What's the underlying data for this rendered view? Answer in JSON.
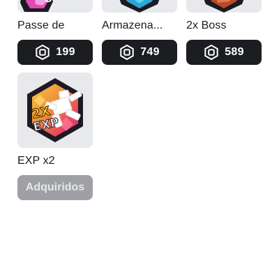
{
  "items": [
    {
      "name": "Passe de",
      "price": "199",
      "icon": "robux-icon",
      "thumb_colors": [
        "#e04bb0",
        "#f0a0e0"
      ]
    },
    {
      "name": "Armazena...",
      "price": "749",
      "icon": "robux-icon",
      "thumb_colors": [
        "#2aa6d8",
        "#5fd0f0"
      ]
    },
    {
      "name": "2x Boss",
      "price": "589",
      "icon": "robux-icon",
      "thumb_colors": [
        "#b84a2a",
        "#e07a4a"
      ]
    },
    {
      "name": "EXP x2",
      "status": "Adquiridos",
      "thumb_badge": "2X EXP"
    }
  ],
  "colors": {
    "button_dark": "#1b1d21",
    "button_disabled": "#9ea0a4",
    "thumb_bg": "#e8e9ec"
  }
}
